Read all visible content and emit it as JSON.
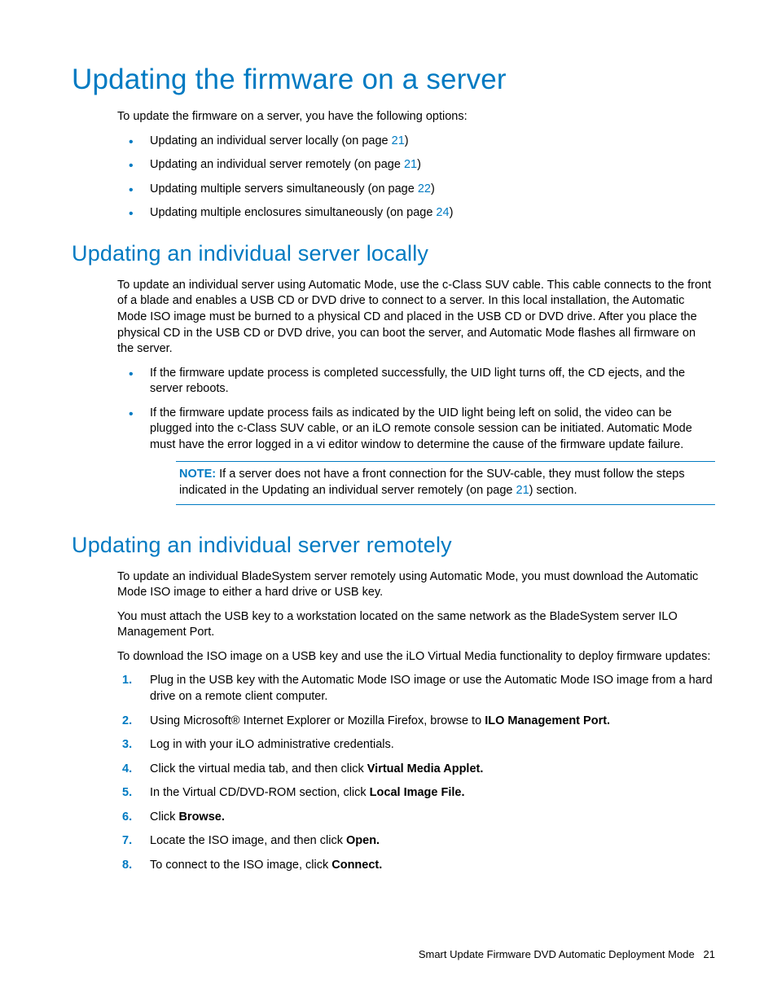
{
  "h1": "Updating the firmware on a server",
  "intro": "To update the firmware on a server, you have the following options:",
  "intro_bullets": [
    {
      "pre": "Updating an individual server locally (on page ",
      "link": "21",
      "post": ")"
    },
    {
      "pre": "Updating an individual server remotely (on page ",
      "link": "21",
      "post": ")"
    },
    {
      "pre": "Updating multiple servers simultaneously (on page ",
      "link": "22",
      "post": ")"
    },
    {
      "pre": "Updating multiple enclosures simultaneously (on page ",
      "link": "24",
      "post": ")"
    }
  ],
  "sec1": {
    "title": "Updating an individual server locally",
    "para1": "To update an individual server using Automatic Mode, use the c-Class SUV cable. This cable connects to the front of a blade and enables a USB CD or DVD drive to connect to a server. In this local installation, the Automatic Mode ISO image must be burned to a physical CD and placed in the USB CD or DVD drive. After you place the physical CD in the USB CD or DVD drive, you can boot the server, and Automatic Mode flashes all firmware on the server.",
    "bullets": [
      "If the firmware update process is completed successfully, the UID light turns off, the CD ejects, and the server reboots.",
      "If the firmware update process fails as indicated by the UID light being left on solid, the video can be plugged into the c-Class SUV cable, or an iLO remote console session can be initiated. Automatic Mode must have the error logged in a vi editor window to determine the cause of the firmware update failure."
    ],
    "note_label": "NOTE:",
    "note_pre": "  If a server does not have a front connection for the SUV-cable, they must follow the steps indicated in the Updating an individual server remotely (on page ",
    "note_link": "21",
    "note_post": ") section."
  },
  "sec2": {
    "title": "Updating an individual server remotely",
    "para1": "To update an individual BladeSystem server remotely using Automatic Mode, you must download the Automatic Mode ISO image to either a hard drive or USB key.",
    "para2": "You must attach the USB key to a workstation located on the same network as the BladeSystem server ILO Management Port.",
    "para3": "To download the ISO image on a USB key and use the iLO Virtual Media functionality to deploy firmware updates:",
    "steps": [
      {
        "text": "Plug in the USB key with the Automatic Mode ISO image or use the Automatic Mode ISO image from a hard drive on a remote client computer."
      },
      {
        "pre": "Using Microsoft® Internet Explorer or Mozilla Firefox, browse to ",
        "bold": "ILO Management Port."
      },
      {
        "text": "Log in with your iLO administrative credentials."
      },
      {
        "pre": "Click the virtual media tab, and then click ",
        "bold": "Virtual Media Applet."
      },
      {
        "pre": "In the Virtual CD/DVD-ROM section, click ",
        "bold": "Local Image File."
      },
      {
        "pre": "Click ",
        "bold": "Browse."
      },
      {
        "pre": "Locate the ISO image, and then click ",
        "bold": "Open."
      },
      {
        "pre": "To connect to the ISO image, click ",
        "bold": "Connect."
      }
    ]
  },
  "footer": {
    "text": "Smart Update Firmware DVD Automatic Deployment Mode",
    "page": "21"
  }
}
